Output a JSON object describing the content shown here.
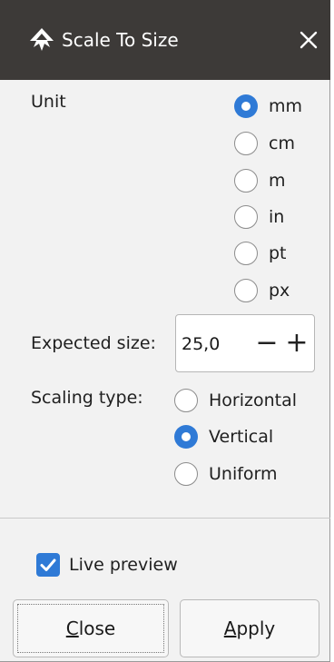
{
  "dialog": {
    "title": "Scale To Size"
  },
  "unit": {
    "label": "Unit",
    "options": [
      "mm",
      "cm",
      "m",
      "in",
      "pt",
      "px"
    ],
    "selected": "mm"
  },
  "expected_size": {
    "label": "Expected size:",
    "value": "25,0",
    "minus": "−",
    "plus": "+"
  },
  "scaling_type": {
    "label": "Scaling type:",
    "options": [
      "Horizontal",
      "Vertical",
      "Uniform"
    ],
    "selected": "Vertical"
  },
  "live_preview": {
    "label": "Live preview",
    "checked": true
  },
  "buttons": {
    "close": {
      "mnemonic": "C",
      "rest": "lose"
    },
    "apply": {
      "mnemonic": "A",
      "rest": "pply"
    }
  },
  "colors": {
    "titlebar": "#3d3a38",
    "accent": "#2f7ad6",
    "background": "#f2f2f2"
  }
}
